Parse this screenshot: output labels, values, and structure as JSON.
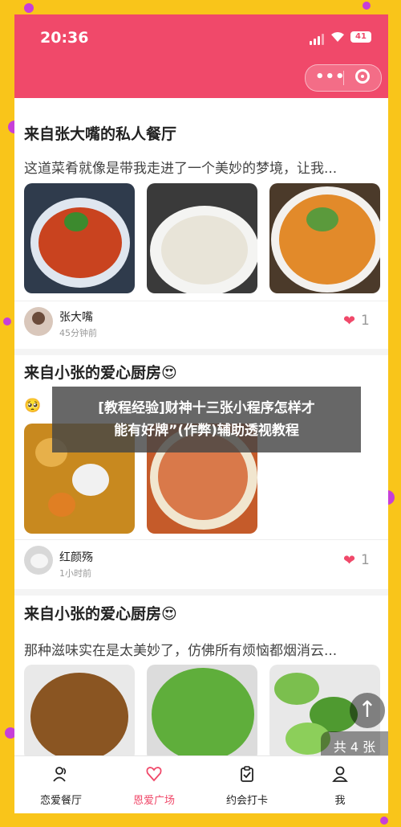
{
  "status_bar": {
    "time": "20:36",
    "battery": "41"
  },
  "capsule": {
    "more": "•••"
  },
  "posts": [
    {
      "title": "来自张大嘴的私人餐厅",
      "desc": "这道菜肴就像是带我走进了一个美妙的梦境，让我...",
      "user": "张大嘴",
      "time": "45分钟前",
      "likes": "1"
    },
    {
      "title": "来自小张的爱心厨房😍",
      "desc": "🥺",
      "user": "红颜殇",
      "time": "1小时前",
      "likes": "1"
    },
    {
      "title": "来自小张的爱心厨房😍",
      "desc": "那种滋味实在是太美妙了，仿佛所有烦恼都烟消云..."
    }
  ],
  "overlay": {
    "line1": "[教程经验]财神十三张小程序怎样才",
    "line2": "能有好牌”(作弊)辅助透视教程"
  },
  "page_badge": "共 4 张",
  "tabs": [
    {
      "label": "恋爱餐厅",
      "icon": "users-icon"
    },
    {
      "label": "恩爱广场",
      "icon": "heart-icon"
    },
    {
      "label": "约会打卡",
      "icon": "clipboard-icon"
    },
    {
      "label": "我",
      "icon": "user-icon"
    }
  ],
  "colors": {
    "accent": "#f0496a",
    "background": "#f9c51a",
    "confetti": "#c63fd9"
  }
}
